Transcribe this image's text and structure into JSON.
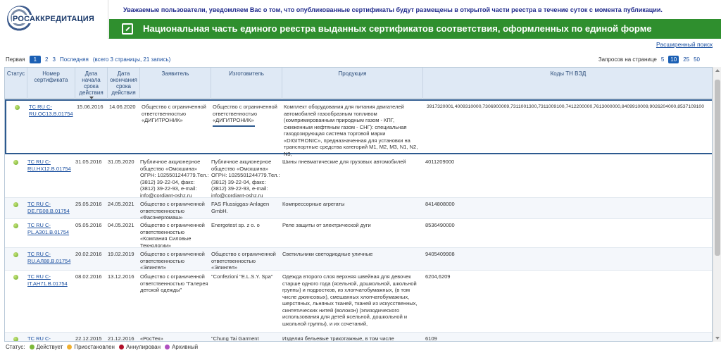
{
  "header": {
    "logo_text": "РОСАККРЕДИТАЦИЯ",
    "notice": "Уважаемые пользователи, уведомляем Вас о том, что опубликованные сертификаты будут размещены в открытой части реестра в течение суток с момента публикации.",
    "title": "Национальная часть единого реестра выданных сертификатов соответствия, оформленных по единой форме",
    "colors": {
      "title_bg": "#2f8f2e",
      "notice_text": "#1f2a8c",
      "link": "#1a4fa0"
    }
  },
  "extended_search": "Расширенный поиск",
  "pager": {
    "first": "Первая",
    "pages": [
      "1",
      "2",
      "3"
    ],
    "current": "1",
    "last": "Последняя",
    "info": "(всего 3 страницы, 21 запись)"
  },
  "per_page": {
    "label": "Запросов на странице",
    "options": [
      "5",
      "10",
      "25",
      "50"
    ],
    "selected": "10"
  },
  "columns": {
    "status": "Статус",
    "number": "Номер сертификата",
    "start": "Дата начала срока действия",
    "end": "Дата окончания срока действия",
    "applicant": "Заявитель",
    "manufacturer": "Изготовитель",
    "product": "Продукция",
    "codes": "Коды ТН ВЭД"
  },
  "rows": [
    {
      "number": "ТС RU С-RU.ОС13.В.01754",
      "start": "15.06.2016",
      "end": "14.06.2020",
      "applicant": "Общество с ограниченной ответственностью «ДИГИТРОНИК»",
      "manufacturer": "Общество с ограниченной ответственностью «ДИГИТРОНИК»",
      "product": "Комплект оборудования для питания двигателей автомобилей газообразным топливом (компримированным природным газом - КПГ, сжиженным нефтяным газом - СНГ): специальная газодозирующая система торговой марки «DIGITRONIC», предназначенная для установки на транспортные средства категорий M1, M2, M3, N1, N2, N3,",
      "codes": "3917320001,4009310000,7306900009,7311001300,7311009100,7412200000,7613000000,8409910009,9026204000,8537109100"
    },
    {
      "number": "ТС RU С-RU.НХ12.В.01754",
      "start": "31.05.2016",
      "end": "31.05.2020",
      "applicant": "Публичное акционерное общество «Омскшина» ОГРН: 1025501244779.Тел.: (3812) 39-22-04, факс: (3812) 39-22-93, e-mail: info@cordiant-oshz.ru",
      "manufacturer": "Публичное акционерное общество «Омскшина» ОГРН: 1025501244779.Тел.: (3812) 39-22-04, факс: (3812) 39-22-93, e-mail: info@cordiant-oshz.ru",
      "product": "Шины пневматические для грузовых автомобилей",
      "codes": "4011209000"
    },
    {
      "number": "ТС RU С-DE.ГБ08.В.01754",
      "start": "25.05.2016",
      "end": "24.05.2021",
      "applicant": "Общество с ограниченной ответственностью «Фасэнергомаш»",
      "manufacturer": "FAS Flussiggas-Anlagen GmbH.",
      "product": "Компрессорные агрегаты",
      "codes": "8414808000"
    },
    {
      "number": "ТС RU С-PL.АЗ01.В.01754",
      "start": "05.05.2016",
      "end": "04.05.2021",
      "applicant": "Общество с ограниченной ответственностью «Компания Силовые Технологии»",
      "manufacturer": "Energotest sp. z o. o",
      "product": "Реле защиты от электрической дуги",
      "codes": "8536490000"
    },
    {
      "number": "ТС RU С-RU.АЛ88.В.01754",
      "start": "20.02.2016",
      "end": "19.02.2019",
      "applicant": "Общество с ограниченной ответственностью «Элингел»",
      "manufacturer": "Общество с ограниченной ответственностью «Элингел»",
      "product": "Светильники светодиодные уличные",
      "codes": "9405409908"
    },
    {
      "number": "ТС RU С-IT.АН71.В.01754",
      "start": "08.02.2016",
      "end": "13.12.2016",
      "applicant": "Общество с ограниченной ответственностью \"Галерея детской одежды\"",
      "manufacturer": "\"Confezioni \"E.L.S.Y. Spa\"",
      "product": "Одежда второго слоя верхняя швейная для девочек старше одного года (ясельной, дошкольной, школьной группы) и подростков, из хлопчатобумажных, (в том числе джинсовых), смешанных хлопчатобумажных, шерстяных, льняных тканей, тканей из искусственных, синтетических нитей (волокон) (эпизодического использования для детей ясельной, дошкольной и школьной группы), и их сочетаний,",
      "codes": "6204,6209"
    },
    {
      "number": "ТС RU С-",
      "start": "22.12.2015",
      "end": "21.12.2016",
      "applicant": "«РосТех»",
      "manufacturer": "\"Chung Tai Garment",
      "product": "Изделия бельевые трикотажные, в том числе",
      "codes": "6109"
    }
  ],
  "legend": {
    "label": "Статус:",
    "items": [
      {
        "label": "Действует",
        "color": "#7cb83a"
      },
      {
        "label": "Приостановлен",
        "color": "#f0b030"
      },
      {
        "label": "Аннулирован",
        "color": "#b0102a"
      },
      {
        "label": "Архивный",
        "color": "#b050c0"
      }
    ]
  }
}
